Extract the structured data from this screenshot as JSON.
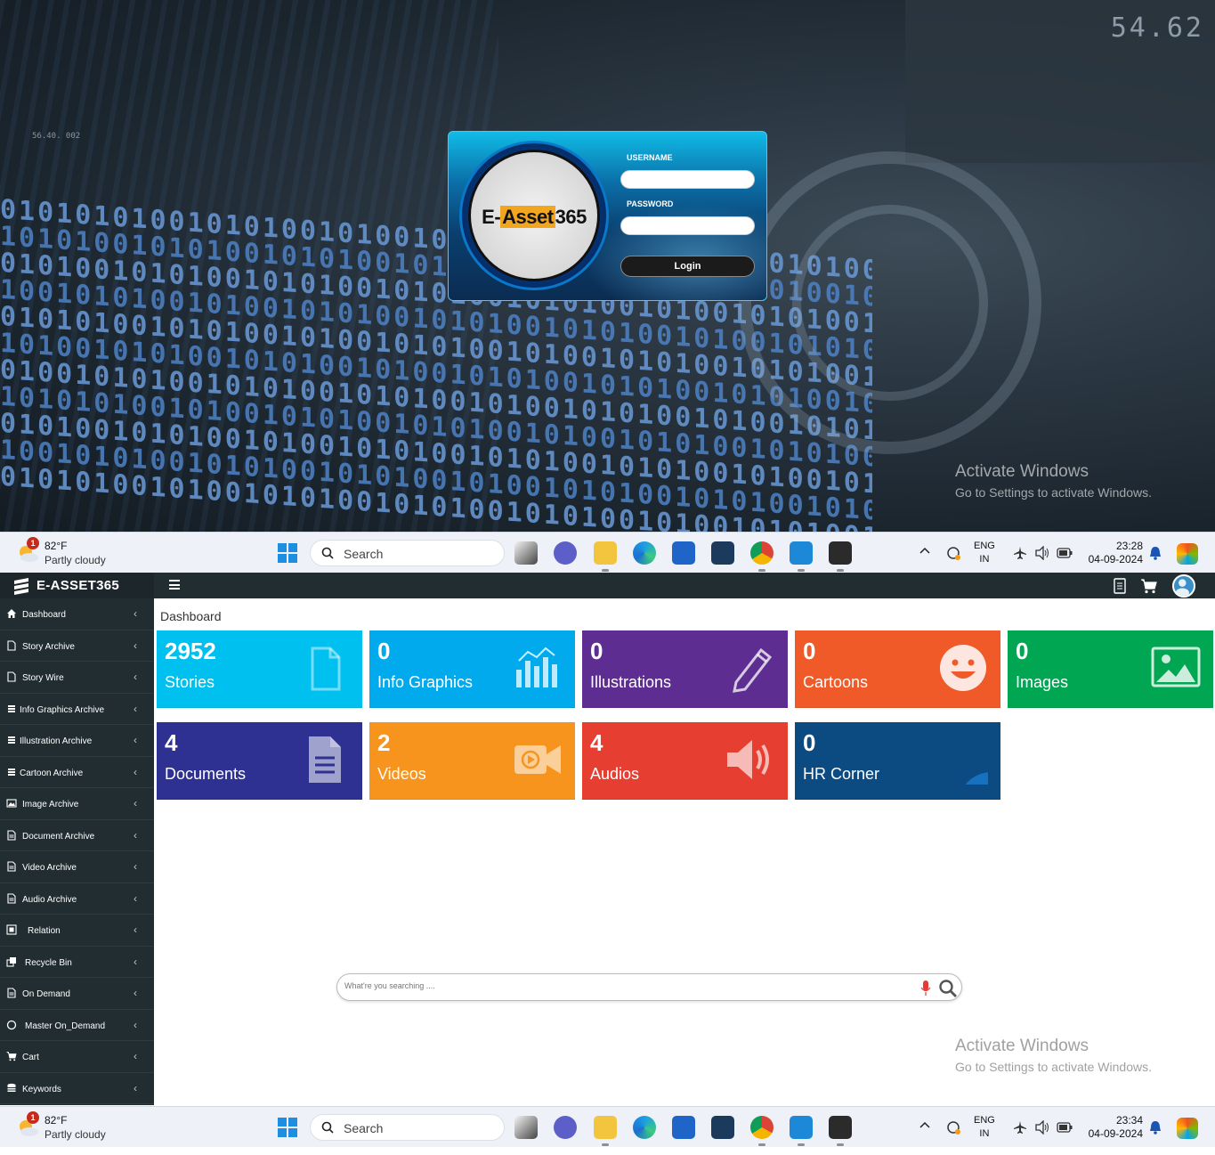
{
  "login_screen": {
    "username_label": "USERNAME",
    "password_label": "PASSWORD",
    "login_button": "Login",
    "logo_text_a": "E-Asset",
    "logo_text_b": "365",
    "bg_readout": "54.62",
    "bg_readout_small": "56.40.  002",
    "activate_title": "Activate Windows",
    "activate_sub": "Go to Settings to activate Windows."
  },
  "taskbar_top": {
    "weather_badge": "1",
    "temperature": "82°F",
    "condition": "Partly cloudy",
    "search_label": "Search",
    "lang_line1": "ENG",
    "lang_line2": "IN",
    "time": "23:28",
    "date": "04-09-2024"
  },
  "taskbar_bottom": {
    "weather_badge": "1",
    "temperature": "82°F",
    "condition": "Partly cloudy",
    "search_label": "Search",
    "lang_line1": "ENG",
    "lang_line2": "IN",
    "time": "23:34",
    "date": "04-09-2024"
  },
  "app": {
    "brand": "E-ASSET365",
    "page_title": "Dashboard",
    "sidebar": [
      {
        "label": "Dashboard",
        "icon": "home-icon"
      },
      {
        "label": "Story Archive",
        "icon": "file-icon"
      },
      {
        "label": "Story Wire",
        "icon": "file-icon"
      },
      {
        "label": "Info Graphics Archive",
        "icon": "bars-icon"
      },
      {
        "label": "Illustration Archive",
        "icon": "bars-icon"
      },
      {
        "label": "Cartoon Archive",
        "icon": "bars-icon"
      },
      {
        "label": "Image Archive",
        "icon": "image-icon"
      },
      {
        "label": "Document Archive",
        "icon": "document-icon"
      },
      {
        "label": "Video Archive",
        "icon": "document-icon"
      },
      {
        "label": "Audio Archive",
        "icon": "document-icon"
      },
      {
        "label": "Relation",
        "icon": "relation-icon"
      },
      {
        "label": "Recycle Bin",
        "icon": "clone-icon"
      },
      {
        "label": "On Demand",
        "icon": "document-icon"
      },
      {
        "label": "Master On_Demand",
        "icon": "circle-icon"
      },
      {
        "label": "Cart",
        "icon": "cart-icon"
      },
      {
        "label": "Keywords",
        "icon": "database-icon"
      }
    ],
    "tiles": [
      {
        "count": "2952",
        "label": "Stories",
        "color": "#00c0ef",
        "icon": "file-outline-icon"
      },
      {
        "count": "0",
        "label": "Info Graphics",
        "color": "#00aaed",
        "icon": "chart-icon"
      },
      {
        "count": "0",
        "label": "Illustrations",
        "color": "#5e2d91",
        "icon": "pencil-icon"
      },
      {
        "count": "0",
        "label": "Cartoons",
        "color": "#f05a28",
        "icon": "smile-icon"
      },
      {
        "count": "0",
        "label": "Images",
        "color": "#00a651",
        "icon": "picture-icon"
      },
      {
        "count": "4",
        "label": "Documents",
        "color": "#2e3192",
        "icon": "document-icon"
      },
      {
        "count": "2",
        "label": "Videos",
        "color": "#f7941d",
        "icon": "video-icon"
      },
      {
        "count": "4",
        "label": "Audios",
        "color": "#e63e31",
        "icon": "speaker-icon"
      },
      {
        "count": "0",
        "label": "HR Corner",
        "color": "#0c4a82",
        "icon": "hr-icon"
      }
    ],
    "search_placeholder": "What're you searching ....",
    "activate_title": "Activate Windows",
    "activate_sub": "Go to Settings to activate Windows."
  }
}
